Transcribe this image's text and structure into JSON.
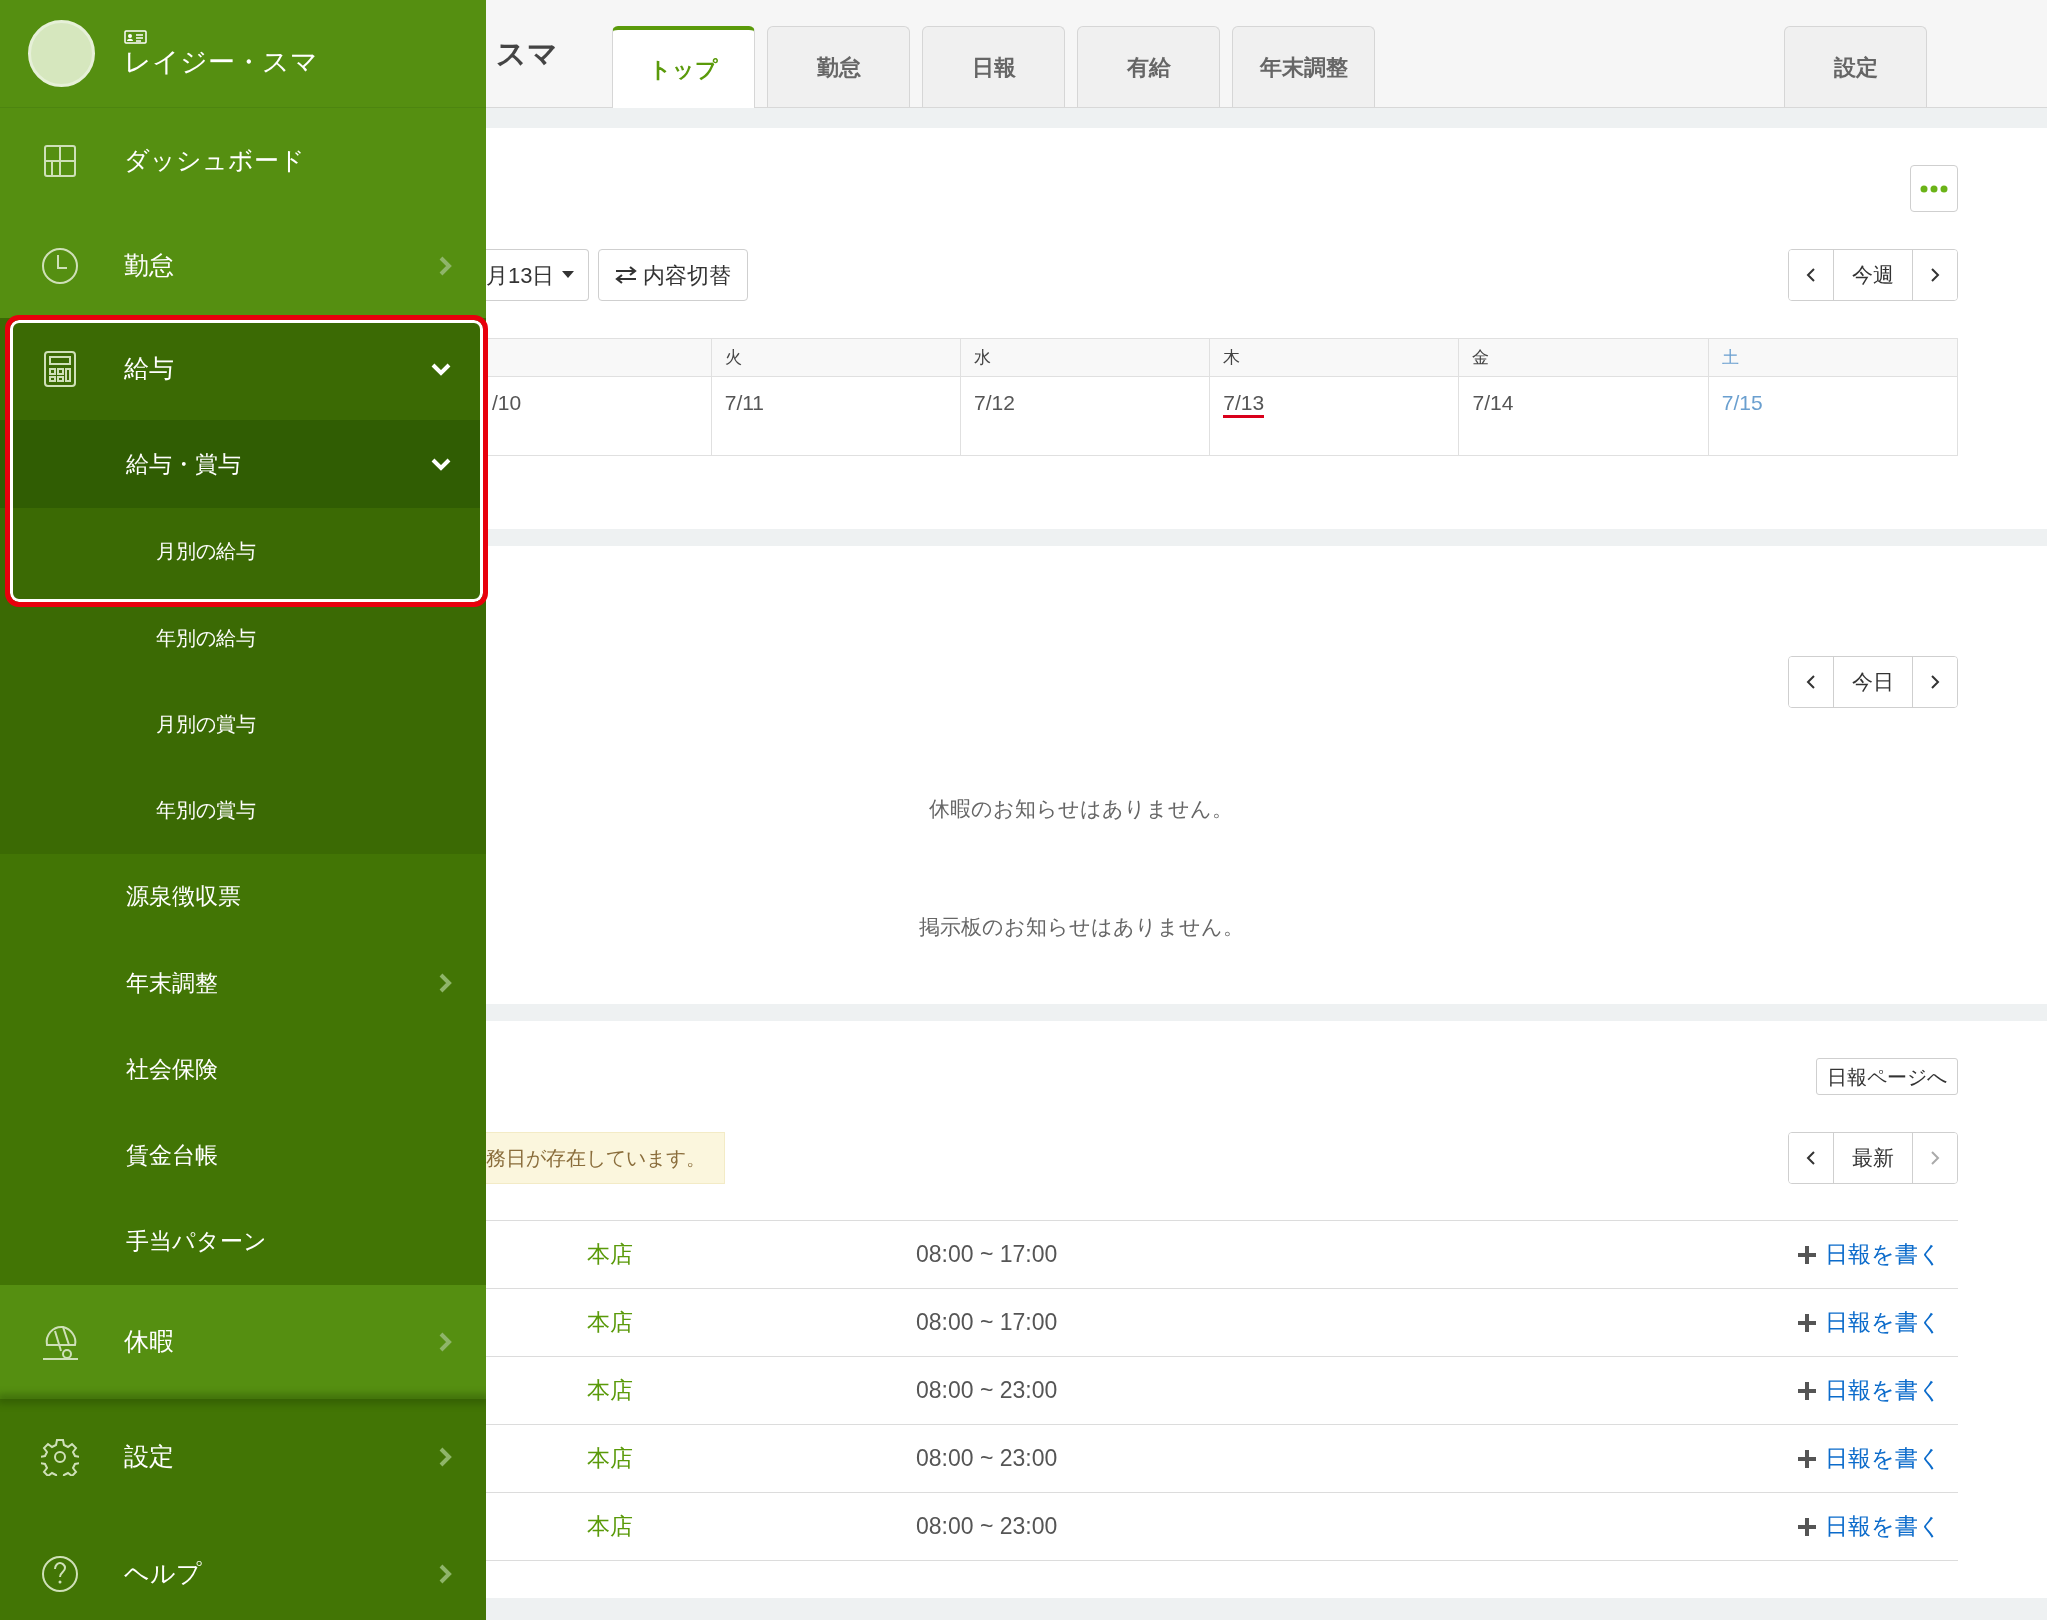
{
  "sidebar": {
    "user": {
      "name": "レイジー・スマ"
    },
    "items": [
      {
        "label": "ダッシュボード",
        "kind": "dashboard"
      },
      {
        "label": "勤怠",
        "kind": "attendance",
        "expanded": false
      },
      {
        "label": "給与",
        "kind": "payroll",
        "expanded": true,
        "children": [
          {
            "label": "給与・賞与",
            "expanded": true,
            "children": [
              {
                "label": "月別の給与"
              },
              {
                "label": "年別の給与"
              },
              {
                "label": "月別の賞与"
              },
              {
                "label": "年別の賞与"
              }
            ]
          },
          {
            "label": "源泉徴収票"
          },
          {
            "label": "年末調整",
            "expanded": false
          },
          {
            "label": "社会保険"
          },
          {
            "label": "賃金台帳"
          },
          {
            "label": "手当パターン"
          }
        ]
      },
      {
        "label": "休暇",
        "kind": "leave",
        "expanded": false
      }
    ],
    "footer_items": [
      {
        "label": "設定",
        "kind": "settings",
        "expanded": false
      },
      {
        "label": "ヘルプ",
        "kind": "help",
        "expanded": false
      }
    ]
  },
  "header": {
    "title": "スマ",
    "tabs": [
      {
        "label": "トップ",
        "selected": true
      },
      {
        "label": "勤怠",
        "selected": false
      },
      {
        "label": "日報",
        "selected": false
      },
      {
        "label": "有給",
        "selected": false
      },
      {
        "label": "年末調整",
        "selected": false
      }
    ],
    "settings_tab": {
      "label": "設定",
      "selected": false
    }
  },
  "week_card": {
    "date_button": "月13日",
    "switch_button": "内容切替",
    "nav": {
      "label": "今週",
      "next_disabled": false
    },
    "days": [
      {
        "date": "/10",
        "today": false,
        "kind": "weekday"
      },
      {
        "day": "火",
        "date": "7/11",
        "today": false,
        "kind": "weekday"
      },
      {
        "day": "水",
        "date": "7/12",
        "today": false,
        "kind": "weekday"
      },
      {
        "day": "木",
        "date": "7/13",
        "today": true,
        "kind": "weekday"
      },
      {
        "day": "金",
        "date": "7/14",
        "today": false,
        "kind": "weekday"
      },
      {
        "day": "土",
        "date": "7/15",
        "today": false,
        "kind": "saturday"
      }
    ]
  },
  "leave_card": {
    "nav": {
      "label": "今日",
      "next_disabled": false
    },
    "messages": [
      "休暇のお知らせはありません。",
      "掲示板のお知らせはありません。"
    ]
  },
  "report_card": {
    "page_button": "日報ページへ",
    "alert": "務日が存在しています。",
    "nav": {
      "label": "最新",
      "next_disabled": true
    },
    "rows": [
      {
        "store": "本店",
        "hours": "08:00 ~ 17:00",
        "action": "日報を書く"
      },
      {
        "store": "本店",
        "hours": "08:00 ~ 17:00",
        "action": "日報を書く"
      },
      {
        "store": "本店",
        "hours": "08:00 ~ 23:00",
        "action": "日報を書く"
      },
      {
        "store": "本店",
        "hours": "08:00 ~ 23:00",
        "action": "日報を書く"
      },
      {
        "store": "本店",
        "hours": "08:00 ~ 23:00",
        "action": "日報を書く"
      }
    ]
  }
}
